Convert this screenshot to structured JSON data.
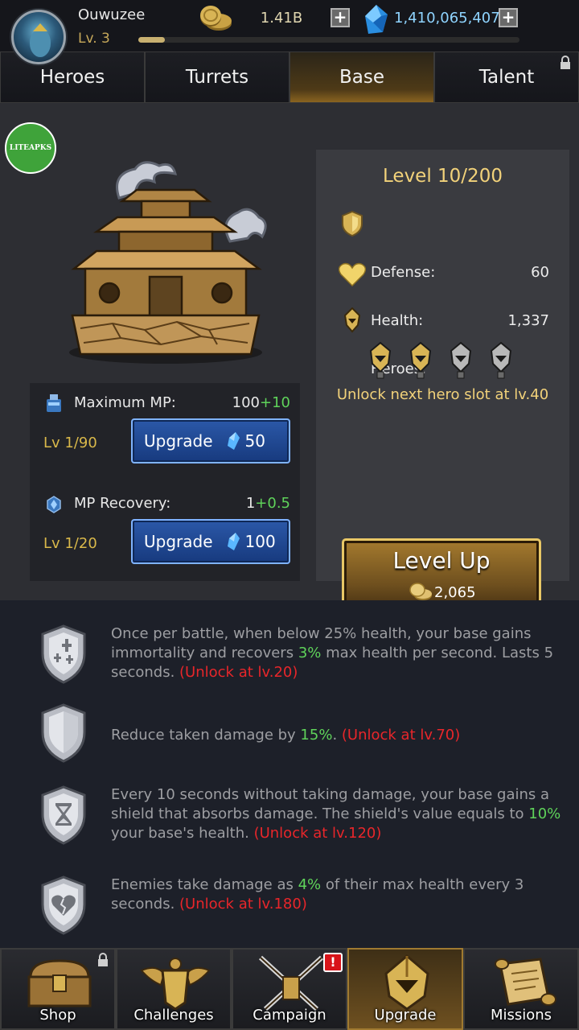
{
  "header": {
    "username": "Ouwuzee",
    "level": "Lv. 3",
    "xp_fraction": 0.07,
    "gold": "1.41B",
    "gems": "1,410,065,407",
    "plus": "+"
  },
  "tabs": [
    {
      "label": "Heroes",
      "active": false,
      "locked": false
    },
    {
      "label": "Turrets",
      "active": false,
      "locked": false
    },
    {
      "label": "Base",
      "active": true,
      "locked": false
    },
    {
      "label": "Talent",
      "active": false,
      "locked": true
    }
  ],
  "watermark": "LITEAPKS",
  "mp": {
    "max": {
      "label": "Maximum MP:",
      "base": "100",
      "bonus": "+10",
      "level": "Lv 1/90",
      "button": "Upgrade",
      "cost": "50"
    },
    "recovery": {
      "label": "MP Recovery:",
      "base": "1",
      "bonus": "+0.5",
      "level": "Lv 1/20",
      "button": "Upgrade",
      "cost": "100"
    }
  },
  "base_stats": {
    "level_title": "Level 10/200",
    "defense_label": "Defense:",
    "defense_value": "60",
    "health_label": "Health:",
    "health_value": "1,337",
    "heroes_label": "Heroes:",
    "hero_slots_unlocked": 2,
    "hero_slots_total": 4,
    "unlock_note": "Unlock next hero slot at lv.40",
    "level_up_label": "Level Up",
    "level_up_cost": "2,065"
  },
  "abilities": [
    {
      "icon": "cross-shield-icon",
      "parts": [
        "Once per battle, when below 25% health, your base gains immortality and recovers ",
        "3%",
        " max health per second. Lasts 5 seconds. ",
        "(Unlock at lv.20)"
      ]
    },
    {
      "icon": "shield-icon",
      "parts": [
        "Reduce taken damage by ",
        "15%",
        ". ",
        "(Unlock at lv.70)"
      ]
    },
    {
      "icon": "hourglass-shield-icon",
      "parts": [
        "Every 10 seconds without taking damage, your base gains a shield that absorbs damage. The shield's value equals to ",
        "10%",
        " your base's health. ",
        "(Unlock at lv.120)"
      ]
    },
    {
      "icon": "broken-heart-shield-icon",
      "parts": [
        "Enemies take damage as ",
        "4%",
        " of their max health every 3 seconds. ",
        "(Unlock at lv.180)"
      ]
    }
  ],
  "bottom_nav": [
    {
      "label": "Shop",
      "icon": "treasure-chest-icon",
      "locked": true,
      "badge": ""
    },
    {
      "label": "Challenges",
      "icon": "winged-armor-icon",
      "locked": false,
      "badge": ""
    },
    {
      "label": "Campaign",
      "icon": "crossed-swords-icon",
      "locked": false,
      "badge": "!"
    },
    {
      "label": "Upgrade",
      "icon": "helmet-icon",
      "locked": false,
      "badge": "",
      "active": true
    },
    {
      "label": "Missions",
      "icon": "scroll-icon",
      "locked": false,
      "badge": ""
    }
  ],
  "colors": {
    "gold_text": "#f2d27a",
    "green": "#5fd35a",
    "red": "#e8262a",
    "upgrade_blue": "#2b58a8"
  }
}
